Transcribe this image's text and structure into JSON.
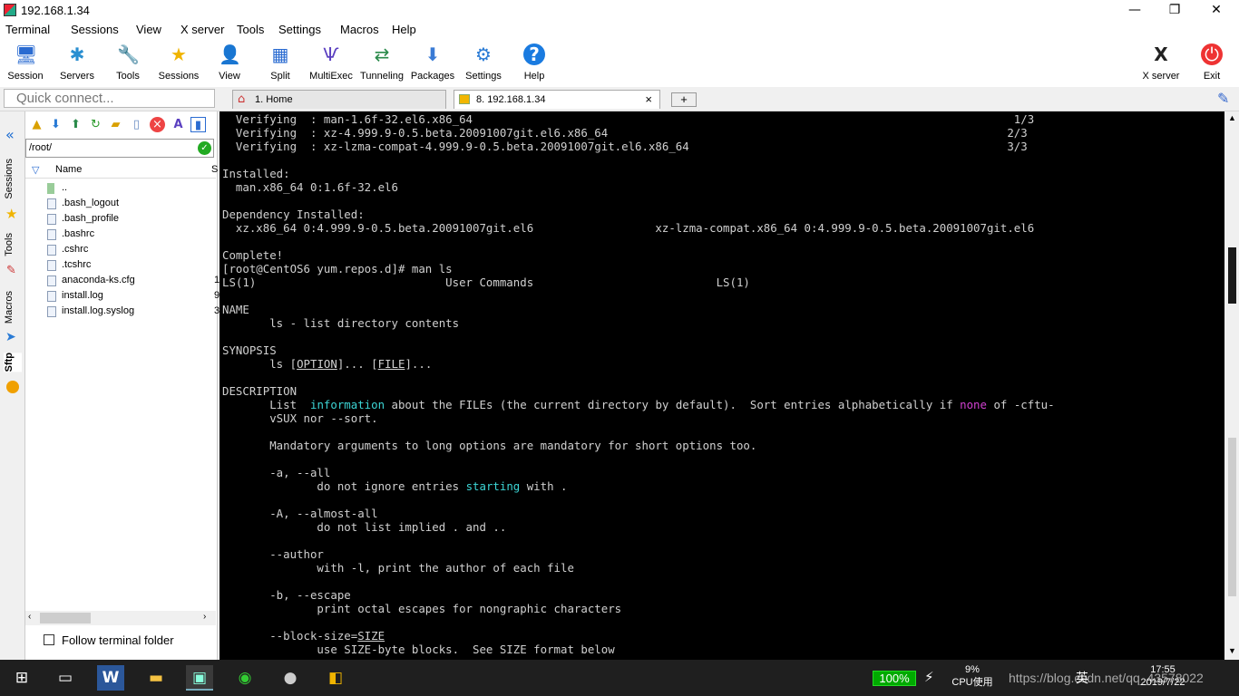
{
  "window": {
    "title": "192.168.1.34",
    "minimize": "—",
    "maximize": "❐",
    "close": "✕"
  },
  "menu": [
    "Terminal",
    "Sessions",
    "View",
    "X server",
    "Tools",
    "Settings",
    "Macros",
    "Help"
  ],
  "toolbar": [
    {
      "label": "Session",
      "icon": "session-icon",
      "glyph": "🖥"
    },
    {
      "label": "Servers",
      "icon": "servers-icon",
      "glyph": "✱"
    },
    {
      "label": "Tools",
      "icon": "tools-icon",
      "glyph": "🔧"
    },
    {
      "label": "Sessions",
      "icon": "star-icon",
      "glyph": "★"
    },
    {
      "label": "View",
      "icon": "view-icon",
      "glyph": "👤"
    },
    {
      "label": "Split",
      "icon": "split-icon",
      "glyph": "▦"
    },
    {
      "label": "MultiExec",
      "icon": "multiexec-icon",
      "glyph": "Ѱ"
    },
    {
      "label": "Tunneling",
      "icon": "tunneling-icon",
      "glyph": "⇄"
    },
    {
      "label": "Packages",
      "icon": "packages-icon",
      "glyph": "⬇"
    },
    {
      "label": "Settings",
      "icon": "settings-icon",
      "glyph": "⚙"
    },
    {
      "label": "Help",
      "icon": "help-icon",
      "glyph": "?"
    }
  ],
  "toolbar_right": [
    {
      "label": "X server",
      "icon": "xserver-icon",
      "glyph": "X"
    },
    {
      "label": "Exit",
      "icon": "exit-icon",
      "glyph": "⏻"
    }
  ],
  "quick_connect": {
    "placeholder": "Quick connect..."
  },
  "tabs": [
    {
      "label": "1. Home",
      "icon": "home-icon"
    },
    {
      "label": "8. 192.168.1.34",
      "icon": "terminal-tab-icon",
      "close": "×"
    }
  ],
  "side_tabs": [
    "Sessions",
    "Tools",
    "Macros",
    "Sftp"
  ],
  "sftp": {
    "path": "/root/",
    "column_name": "Name",
    "column_size": "S",
    "files": [
      {
        "name": "..",
        "size": ""
      },
      {
        "name": ".bash_logout",
        "size": ""
      },
      {
        "name": ".bash_profile",
        "size": ""
      },
      {
        "name": ".bashrc",
        "size": ""
      },
      {
        "name": ".cshrc",
        "size": ""
      },
      {
        "name": ".tcshrc",
        "size": ""
      },
      {
        "name": "anaconda-ks.cfg",
        "size": "1"
      },
      {
        "name": "install.log",
        "size": "9"
      },
      {
        "name": "install.log.syslog",
        "size": "3"
      }
    ],
    "follow_label": "Follow terminal folder"
  },
  "terminal": {
    "lines": [
      {
        "text": "  Verifying  : man-1.6f-32.el6.x86_64                                                                                1/3"
      },
      {
        "text": "  Verifying  : xz-4.999.9-0.5.beta.20091007git.el6.x86_64                                                           2/3"
      },
      {
        "text": "  Verifying  : xz-lzma-compat-4.999.9-0.5.beta.20091007git.el6.x86_64                                               3/3"
      },
      {
        "text": ""
      },
      {
        "text": "Installed:"
      },
      {
        "text": "  man.x86_64 0:1.6f-32.el6"
      },
      {
        "text": ""
      },
      {
        "text": "Dependency Installed:"
      },
      {
        "text": "  xz.x86_64 0:4.999.9-0.5.beta.20091007git.el6                  xz-lzma-compat.x86_64 0:4.999.9-0.5.beta.20091007git.el6"
      },
      {
        "text": ""
      },
      {
        "text": "Complete!"
      },
      {
        "text": "[root@CentOS6 yum.repos.d]# man ls"
      },
      {
        "text": "LS(1)                            User Commands                           LS(1)"
      },
      {
        "text": ""
      },
      {
        "text": "NAME"
      },
      {
        "text": "       ls - list directory contents"
      },
      {
        "text": ""
      },
      {
        "text": "SYNOPSIS"
      },
      {
        "segments": [
          {
            "t": "       ls ["
          },
          {
            "t": "OPTION",
            "c": "ul"
          },
          {
            "t": "]... ["
          },
          {
            "t": "FILE",
            "c": "ul"
          },
          {
            "t": "]..."
          }
        ]
      },
      {
        "text": ""
      },
      {
        "text": "DESCRIPTION"
      },
      {
        "segments": [
          {
            "t": "       List  "
          },
          {
            "t": "information",
            "c": "hl"
          },
          {
            "t": " about the FILEs (the current directory by default).  Sort entries alphabetically if "
          },
          {
            "t": "none",
            "c": "mg"
          },
          {
            "t": " of -cftu-"
          }
        ]
      },
      {
        "text": "       vSUX nor --sort."
      },
      {
        "text": ""
      },
      {
        "text": "       Mandatory arguments to long options are mandatory for short options too."
      },
      {
        "text": ""
      },
      {
        "text": "       -a, --all"
      },
      {
        "segments": [
          {
            "t": "              do not ignore entries "
          },
          {
            "t": "starting",
            "c": "hl"
          },
          {
            "t": " with ."
          }
        ]
      },
      {
        "text": ""
      },
      {
        "text": "       -A, --almost-all"
      },
      {
        "text": "              do not list implied . and .."
      },
      {
        "text": ""
      },
      {
        "text": "       --author"
      },
      {
        "text": "              with -l, print the author of each file"
      },
      {
        "text": ""
      },
      {
        "text": "       -b, --escape"
      },
      {
        "text": "              print octal escapes for nongraphic characters"
      },
      {
        "text": ""
      },
      {
        "segments": [
          {
            "t": "       --block-size="
          },
          {
            "t": "SIZE",
            "c": "ul"
          }
        ]
      },
      {
        "text": "              use SIZE-byte blocks.  See SIZE format below"
      }
    ]
  },
  "taskbar": {
    "apps": [
      {
        "icon": "windows-start-icon",
        "glyph": "⊞"
      },
      {
        "icon": "task-view-icon",
        "glyph": "▭"
      },
      {
        "icon": "word-icon",
        "glyph": "W"
      },
      {
        "icon": "file-explorer-icon",
        "glyph": "▬"
      },
      {
        "icon": "mobaxterm-icon",
        "glyph": "▣"
      },
      {
        "icon": "browser-icon",
        "glyph": "◉"
      },
      {
        "icon": "avatar-app-icon",
        "glyph": "●"
      },
      {
        "icon": "app-icon-yellow",
        "glyph": "◧"
      }
    ],
    "battery": "100%",
    "cpu_percent": "9%",
    "cpu_label": "CPU使用",
    "tray_text": "https://blog.csdn.net/qq_43578022",
    "ime": "英",
    "time": "17:55",
    "date": "2019/7/22"
  }
}
